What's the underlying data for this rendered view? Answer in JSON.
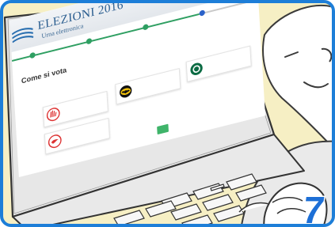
{
  "app": {
    "title": "ELEZIONI 2016",
    "subtitle": "Urna elettronica"
  },
  "steps": [
    {
      "label": "",
      "state": "done"
    },
    {
      "label": "",
      "state": "done"
    },
    {
      "label": "",
      "state": "done"
    },
    {
      "label": "",
      "state": "current"
    }
  ],
  "main": {
    "heading": "Come si vota",
    "instructions": [
      "",
      "",
      ""
    ]
  },
  "candidates": [
    {
      "label": "",
      "symbol": "red-hand-symbol"
    },
    {
      "label": "",
      "symbol": "batman-symbol"
    },
    {
      "label": "",
      "symbol": "starbucks-symbol"
    },
    {
      "label": "",
      "symbol": "red-bird-symbol"
    }
  ],
  "vote_button": {
    "label": ""
  },
  "badge": {
    "number": "7"
  },
  "colors": {
    "frame_border": "#1d7ed8",
    "background": "#f6efc4",
    "progress_green": "#2f9f62",
    "current_step_blue": "#2b62c9",
    "vote_button_green": "#3fb46a",
    "badge_blue": "#1d6fd6"
  }
}
